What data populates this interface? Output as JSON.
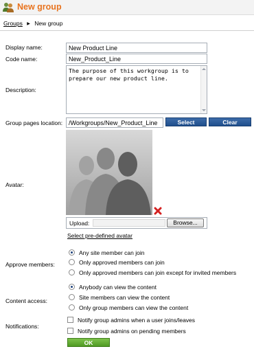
{
  "header": {
    "title": "New group",
    "icon": "group-icon"
  },
  "breadcrumb": {
    "root": "Groups",
    "current": "New group"
  },
  "form": {
    "display_name": {
      "label": "Display name:",
      "value": "New Product Line"
    },
    "code_name": {
      "label": "Code name:",
      "value": "New_Product_Line"
    },
    "description": {
      "label": "Description:",
      "value": "The purpose of this workgroup is to prepare our new product line."
    },
    "group_pages_location": {
      "label": "Group pages location:",
      "value": "/Workgroups/New_Product_Line",
      "select_label": "Select",
      "clear_label": "Clear"
    },
    "avatar": {
      "label": "Avatar:",
      "upload_label": "Upload:",
      "browse_label": "Browse...",
      "predefined_link": "Select pre-defined avatar"
    },
    "approve_members": {
      "label": "Approve members:",
      "options": [
        "Any site member can join",
        "Only approved members can join",
        "Only approved members can join except for invited members"
      ],
      "selected_index": 0
    },
    "content_access": {
      "label": "Content access:",
      "options": [
        "Anybody can view the content",
        "Site members can view the content",
        "Only group members can view the content"
      ],
      "selected_index": 0
    },
    "notifications": {
      "label": "Notifications:",
      "options": [
        "Notify group admins when a user joins/leaves",
        "Notify group admins on pending members"
      ]
    },
    "ok_label": "OK"
  },
  "colors": {
    "title": "#e8731e",
    "button_blue": "#2a5a9a",
    "button_green": "#5aa62c"
  }
}
